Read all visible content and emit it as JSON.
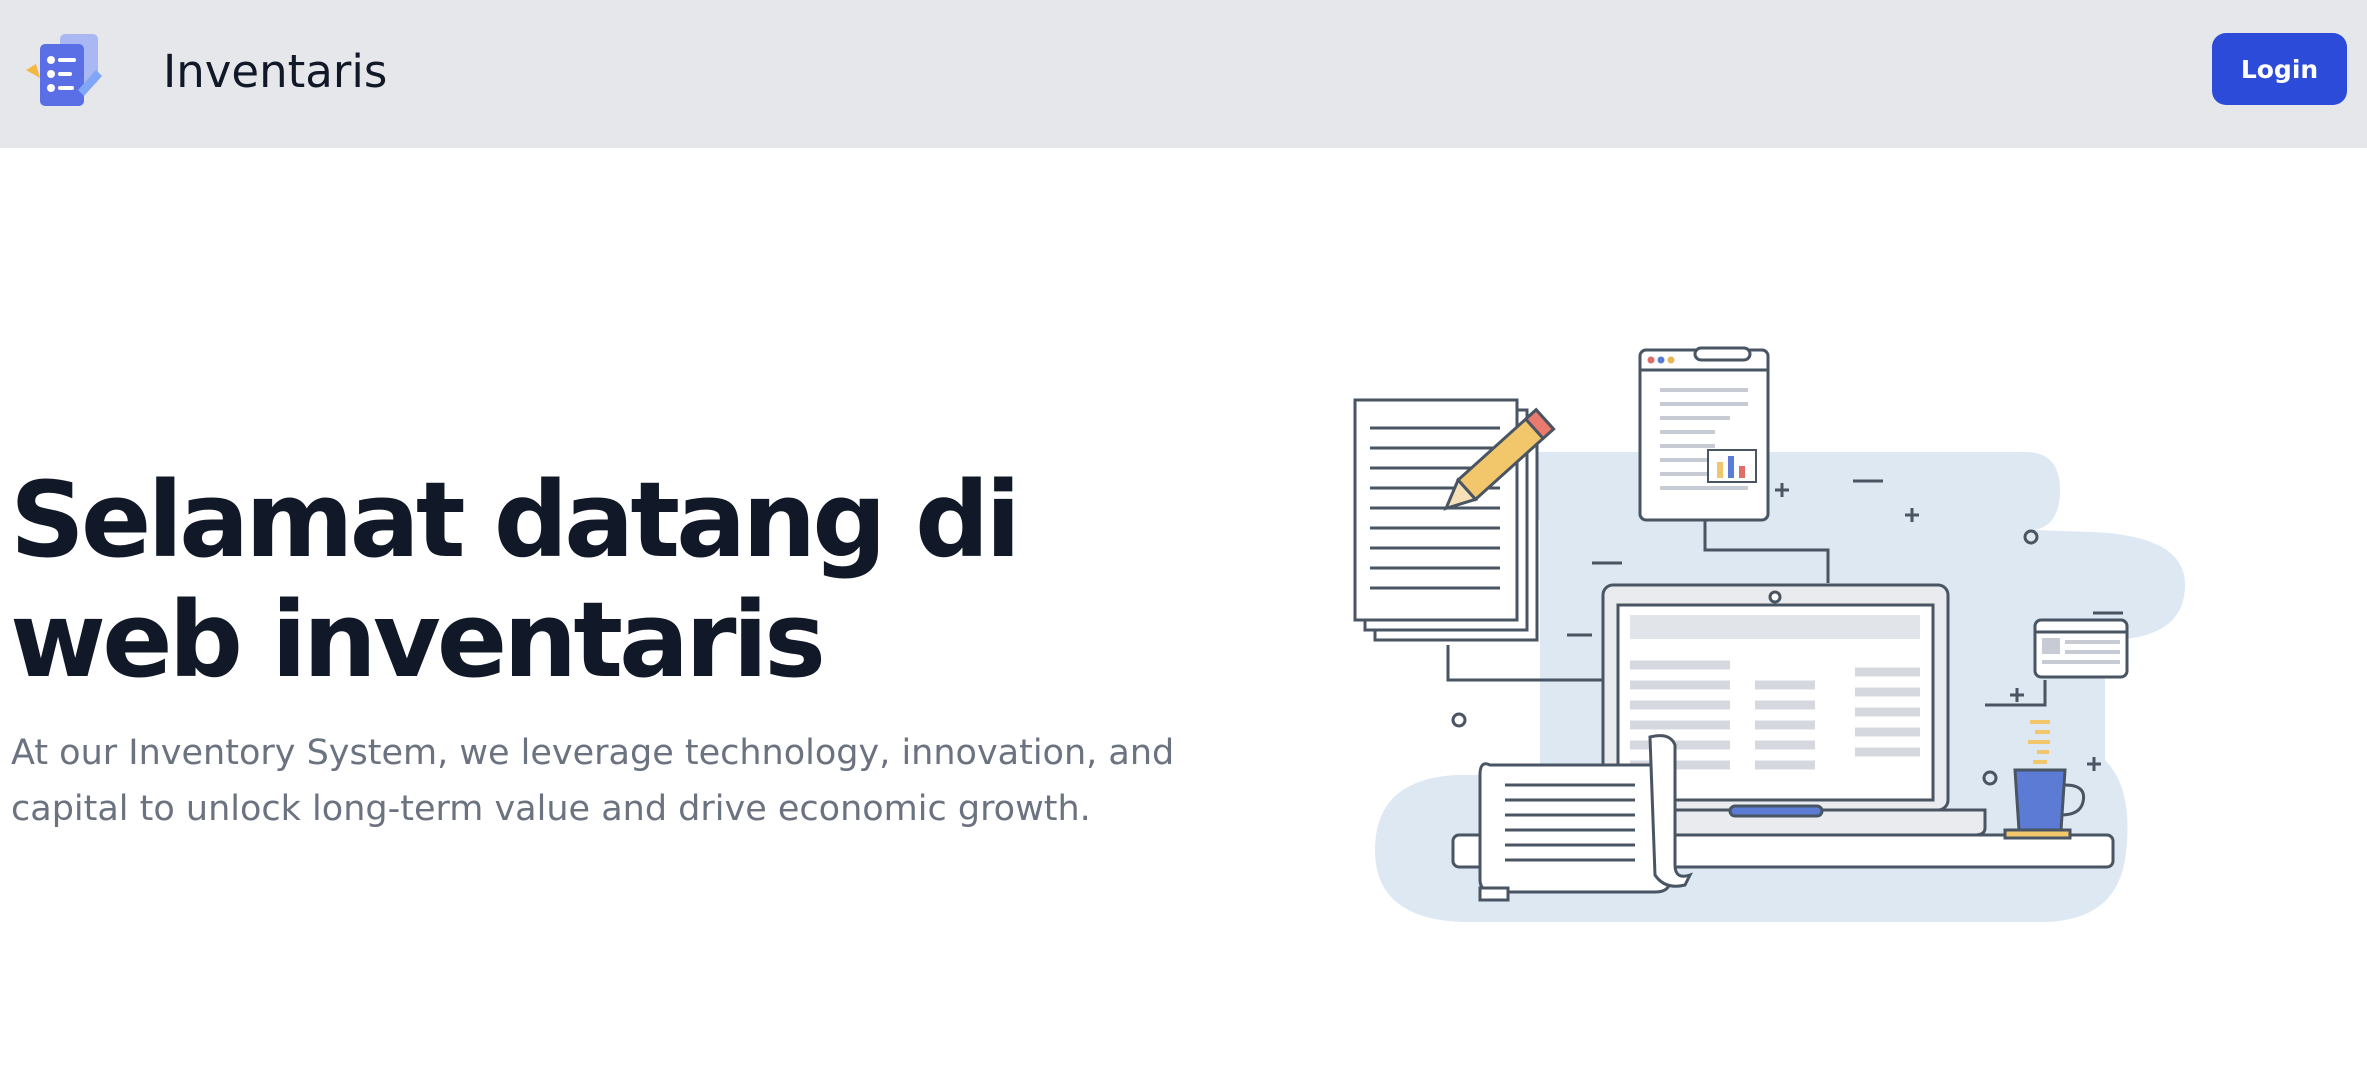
{
  "navbar": {
    "brand_name": "Inventaris",
    "logo_icon": "clipboard-list-icon",
    "login_label": "Login",
    "login_color": "#2b4bd8",
    "background": "#e5e7eb"
  },
  "hero": {
    "title_lines": [
      "Selamat datang di",
      "web inventaris"
    ],
    "description_lines": [
      "At our Inventory System, we leverage technology, innovation, and",
      "capital to unlock long-term value and drive economic growth."
    ],
    "illustration": "workspace-laptop-documents-illustration"
  }
}
